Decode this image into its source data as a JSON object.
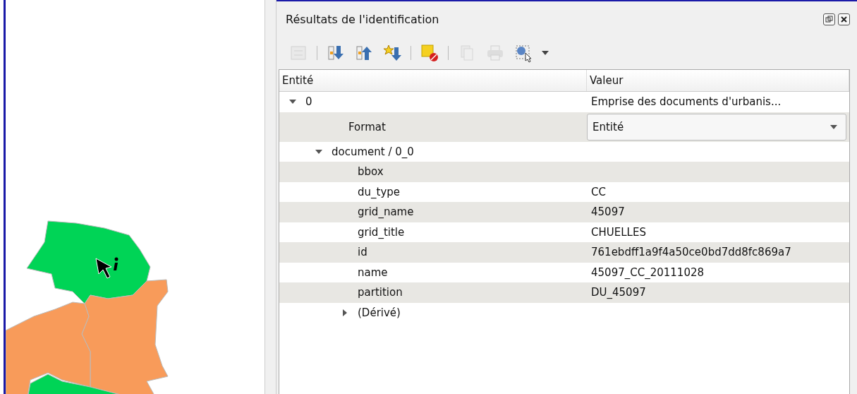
{
  "panel": {
    "title": "Résultats de l'identification"
  },
  "toolbar": [
    {
      "kind": "expand-tree",
      "disabled": true
    },
    {
      "kind": "separator"
    },
    {
      "kind": "expand-all",
      "disabled": false
    },
    {
      "kind": "collapse-all",
      "disabled": false
    },
    {
      "kind": "new-features",
      "disabled": false
    },
    {
      "kind": "separator"
    },
    {
      "kind": "clear-highlight",
      "disabled": false
    },
    {
      "kind": "separator"
    },
    {
      "kind": "copy",
      "disabled": true
    },
    {
      "kind": "print",
      "disabled": true
    },
    {
      "kind": "identify-mode",
      "disabled": false
    }
  ],
  "table": {
    "columns": [
      "Entité",
      "Valeur"
    ],
    "rows": [
      {
        "label": "0",
        "value": "Emprise des documents d'urbanis...",
        "expanded": true,
        "children": [
          {
            "label": "Format",
            "kind": "combo",
            "value": "Entité"
          },
          {
            "label": "document / 0_0",
            "expanded": true,
            "children": [
              {
                "label": "bbox"
              },
              {
                "label": "du_type",
                "value": "CC"
              },
              {
                "label": "grid_name",
                "value": "45097"
              },
              {
                "label": "grid_title",
                "value": "CHUELLES"
              },
              {
                "label": "id",
                "value": "761ebdff1a9f4a50ce0bd7dd8fc869a7"
              },
              {
                "label": "name",
                "value": "45097_CC_20111028"
              },
              {
                "label": "partition",
                "value": "DU_45097"
              },
              {
                "label": "(Dérivé)",
                "expanded": false
              }
            ]
          }
        ]
      }
    ]
  }
}
